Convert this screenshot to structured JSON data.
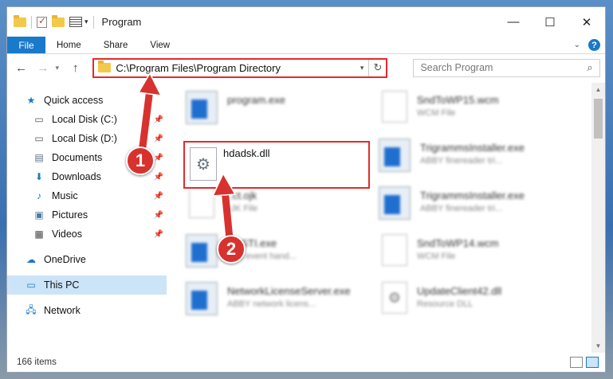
{
  "window": {
    "title": "Program",
    "minimize_glyph": "—",
    "maximize_glyph": "☐",
    "close_glyph": "✕"
  },
  "ribbon": {
    "file": "File",
    "tabs": [
      "Home",
      "Share",
      "View"
    ],
    "help": "?"
  },
  "address": {
    "path": "C:\\Program Files\\Program Directory",
    "search_placeholder": "Search Program"
  },
  "sidebar": {
    "quick_access": "Quick access",
    "items": [
      {
        "label": "Local Disk (C:)",
        "icon": "drive-icon",
        "pinned": true
      },
      {
        "label": "Local Disk (D:)",
        "icon": "drive-icon",
        "pinned": true
      },
      {
        "label": "Documents",
        "icon": "documents-icon",
        "pinned": true
      },
      {
        "label": "Downloads",
        "icon": "downloads-icon",
        "pinned": true
      },
      {
        "label": "Music",
        "icon": "music-icon",
        "pinned": true
      },
      {
        "label": "Pictures",
        "icon": "pictures-icon",
        "pinned": true
      },
      {
        "label": "Videos",
        "icon": "videos-icon",
        "pinned": true
      }
    ],
    "onedrive": "OneDrive",
    "this_pc": "This PC",
    "network": "Network"
  },
  "files": [
    {
      "name": "program.exe",
      "type": "",
      "icon": "installer-icon"
    },
    {
      "name": "SndToWP15.wcm",
      "type": "WCM File",
      "icon": "document-icon"
    },
    {
      "name": "hdadsk.dll",
      "type": "",
      "icon": "dll-gear-icon",
      "highlighted": true
    },
    {
      "name": "TrigrammsInstaller.exe",
      "type": "ABBY finereader tri...",
      "icon": "exe-icon"
    },
    {
      "name": "...ct.ojk",
      "type": "OJK File",
      "icon": "document-icon"
    },
    {
      "name": "TrigrammsInstaller.exe",
      "type": "ABBY finereader tri...",
      "icon": "exe-icon"
    },
    {
      "name": "...ySTI.exe",
      "type": "...sti event hand...",
      "icon": "exe-icon"
    },
    {
      "name": "SndToWP14.wcm",
      "type": "WCM File",
      "icon": "document-icon"
    },
    {
      "name": "NetworkLicenseServer.exe",
      "type": "ABBY network licens...",
      "icon": "exe-icon"
    },
    {
      "name": "UpdateClient42.dll",
      "type": "Resource DLL",
      "icon": "dll-gear-icon"
    }
  ],
  "status": {
    "count": "166 items"
  },
  "callouts": [
    "1",
    "2"
  ],
  "colors": {
    "accent": "#1979ca",
    "highlight_red": "#e32a2a",
    "callout_red": "#d8322f",
    "selected_bg": "#cce4f7"
  }
}
